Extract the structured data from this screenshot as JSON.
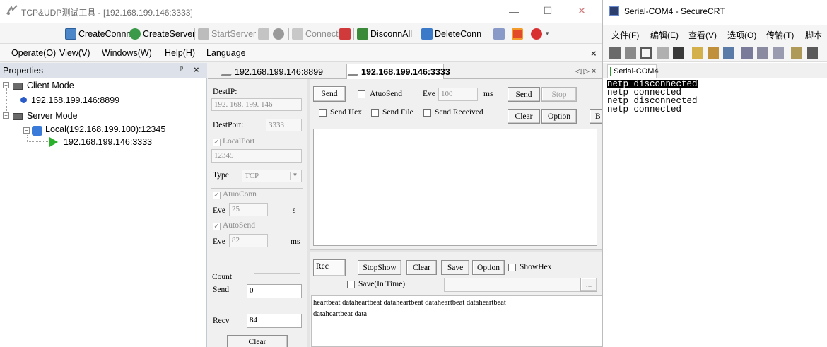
{
  "tcp_app": {
    "title": "TCP&UDP测试工具 - [192.168.199.146:3333]",
    "toolbar": {
      "create_conn": "CreateConnn",
      "create_server": "CreateServer",
      "start_server": "StartServer",
      "connect": "Connect",
      "disconn_all": "DisconnAll",
      "delete_conn": "DeleteConn"
    },
    "menu": [
      "Operate(O)",
      "View(V)",
      "Windows(W)",
      "Help(H)",
      "Language"
    ],
    "properties": {
      "title": "Properties",
      "pin": "ᵖ",
      "close": "×",
      "client_mode": "Client Mode",
      "client_item": "192.168.199.146:8899",
      "server_mode": "Server Mode",
      "server_local": "Local(192.168.199.100):12345",
      "server_item": "192.168.199.146:3333"
    },
    "tabs": [
      "192.168.199.146:8899",
      "192.168.199.146:3333"
    ],
    "tab_nav": "◁ ▷ ×",
    "left_panel": {
      "dest_ip_label": "DestIP:",
      "dest_ip": "192. 168. 199. 146",
      "dest_port_label": "DestPort:",
      "dest_port": "3333",
      "local_port_label": "LocalPort",
      "local_port": "12345",
      "type_label": "Type",
      "type_value": "TCP",
      "auto_conn_label": "AtuoConn",
      "eve_label": "Eve",
      "auto_conn_eve": "25",
      "unit_s": "s",
      "auto_send_label": "AutoSend",
      "auto_send_eve": "82",
      "unit_ms": "ms",
      "count_label": "Count",
      "send_label": "Send",
      "send_count": "0",
      "recv_label": "Recv",
      "recv_count": "84",
      "clear_button": "Clear"
    },
    "send_section": {
      "send_badge": "Send",
      "auto_send_label": "AtuoSend",
      "eve_label": "Eve",
      "eve_value": "100",
      "unit_ms": "ms",
      "send_button": "Send",
      "stop_button": "Stop",
      "send_hex": "Send Hex",
      "send_file": "Send File",
      "send_received": "Send Received",
      "clear_button": "Clear",
      "option_button": "Option",
      "extra_button": "B"
    },
    "rec_section": {
      "rec_badge": "Rec",
      "stop_show_button": "StopShow",
      "clear_button": "Clear",
      "save_button": "Save",
      "option_button": "Option",
      "show_hex": "ShowHex",
      "save_in_time": "Save(In Time)",
      "browse_button": "...",
      "content_line1": "heartbeat dataheartbeat dataheartbeat dataheartbeat dataheartbeat",
      "content_line2": "dataheartbeat data"
    }
  },
  "crt_app": {
    "title": "Serial-COM4 - SecureCRT",
    "menu": [
      "文件(F)",
      "编辑(E)",
      "查看(V)",
      "选项(O)",
      "传输(T)",
      "脚本"
    ],
    "tab": "Serial-COM4",
    "terminal_lines": [
      "netp disconnected",
      "netp connected",
      "netp disconnected",
      "netp connected"
    ]
  },
  "colors": {
    "accent_blue": "#1e5aa8",
    "tab_active": "#ffffff",
    "terminal_highlight": "#000000"
  }
}
